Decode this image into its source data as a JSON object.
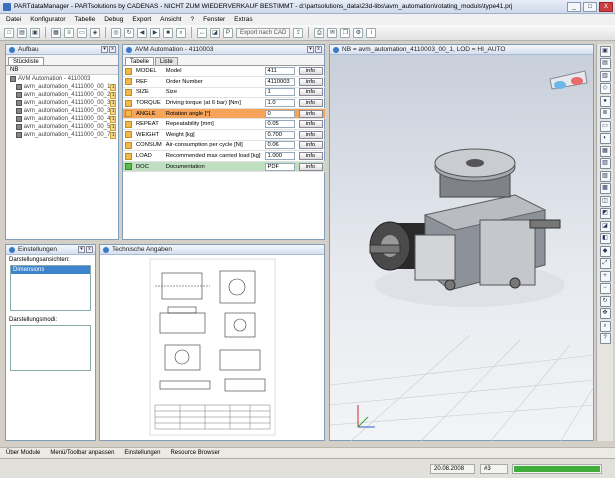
{
  "app": {
    "title": "PARTdataManager - PARTsolutions by CADENAS - NICHT ZUM WIEDERVERKAUF BESTIMMT - d:\\partsolutions_data\\23d-libs\\avm_automation\\rotating_moduls\\type41.prj"
  },
  "window_buttons": [
    "_",
    "□",
    "X"
  ],
  "menu": [
    "Datei",
    "Konfigurator",
    "Tabelle",
    "Debug",
    "Export",
    "Ansicht",
    "?",
    "Fenster",
    "Extras"
  ],
  "toolbar": {
    "export_label": "Export nach CAD"
  },
  "aufbau": {
    "title": "Aufbau",
    "tab": "Stückliste",
    "column_header": "NB",
    "root": "AVM Automation - 4110003",
    "items": [
      {
        "label": "avm_automation_4111000_00_1",
        "num": "1"
      },
      {
        "label": "avm_automation_4111000_00_2",
        "num": "1"
      },
      {
        "label": "avm_automation_4111000_00_3",
        "num": "1"
      },
      {
        "label": "avm_automation_4111000_00_3",
        "num": "1"
      },
      {
        "label": "avm_automation_4111000_00_4",
        "num": "1"
      },
      {
        "label": "avm_automation_4111000_00_5",
        "num": "1"
      },
      {
        "label": "avm_automation_4111000_00_7",
        "num": "1"
      }
    ]
  },
  "avm": {
    "title": "AVM Automation - 4110003",
    "tabs": [
      "Tabelle",
      "Liste"
    ],
    "info_label": "info",
    "rows": [
      {
        "code": "MODEL",
        "desc": "Model",
        "value": "411",
        "hl": ""
      },
      {
        "code": "REF",
        "desc": "Order Number",
        "value": "4110003",
        "hl": ""
      },
      {
        "code": "SIZE",
        "desc": "Size",
        "value": "1",
        "hl": ""
      },
      {
        "code": "TORQUE",
        "desc": "Driving torque (at 6 bar) [Nm]",
        "value": "1.0",
        "hl": ""
      },
      {
        "code": "ANGLE",
        "desc": "Rotation angle [°]",
        "value": "0",
        "hl": "orange"
      },
      {
        "code": "REPEAT",
        "desc": "Repeatability [mm]",
        "value": "0.05",
        "hl": ""
      },
      {
        "code": "WEIGHT",
        "desc": "Weight [kg]",
        "value": "0.700",
        "hl": ""
      },
      {
        "code": "CONSUM",
        "desc": "Air-consumption per cycle [Nl]",
        "value": "0.06",
        "hl": ""
      },
      {
        "code": "LOAD",
        "desc": "Recommended max carried load [kg]",
        "value": "1.000",
        "hl": ""
      },
      {
        "code": "DOC",
        "desc": "Documentation",
        "value": "PDF",
        "hl": "green"
      }
    ]
  },
  "view3d": {
    "title": "NB = avm_automation_4110003_00_1, LOD = HI_AUTO"
  },
  "einstellungen": {
    "title": "Einstellungen",
    "label1": "Darstellungsansichten:",
    "selected": "Dimensions",
    "label2": "Darstellungsmodi:"
  },
  "tech": {
    "title": "Technische Angaben"
  },
  "statusbar": [
    "Über Module",
    "Menü/Toolbar anpassen",
    "Einstellungen",
    "Resource Browser"
  ],
  "bottom": {
    "date": "20.08.2008",
    "count": "#3",
    "progress": 1.0
  },
  "colors": {
    "orange": "#f6a45a",
    "green": "#bfe0c0",
    "accent": "#3d84cc",
    "progress": "#3fae3a"
  },
  "right_tools": [
    "cube-front",
    "cube-top",
    "cube-side",
    "cube-iso",
    "color",
    "layers",
    "screen",
    "palette",
    "view1",
    "view2",
    "view3",
    "view4",
    "view5",
    "view6",
    "view7",
    "view8",
    "shade",
    "fit",
    "zoom-in",
    "zoom-out",
    "rotate",
    "pan",
    "search",
    "help"
  ]
}
